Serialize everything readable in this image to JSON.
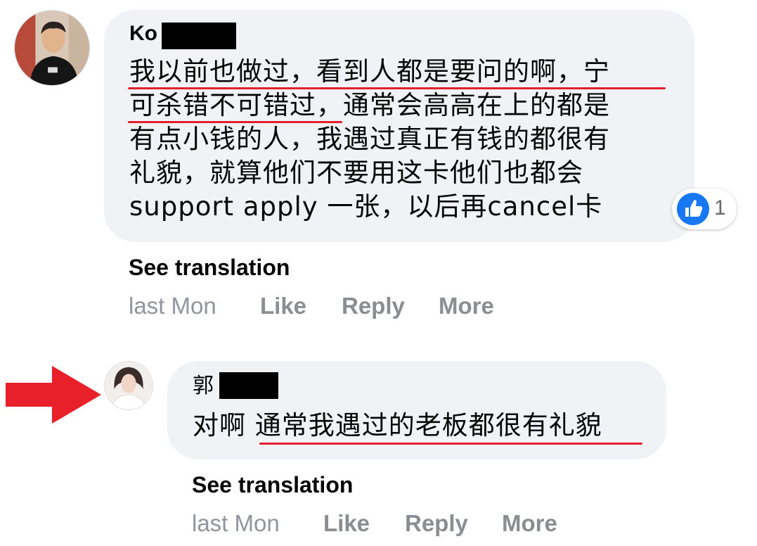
{
  "comments": [
    {
      "author_visible": "Ko",
      "lines": [
        "我以前也做过，看到人都是要问的啊，宁",
        "可杀错不可错过，通常会高高在上的都是",
        "有点小钱的人，我遇过真正有钱的都很有",
        "礼貌，就算他们不要用这卡他们也都会",
        "support apply 一张，以后再cancel卡"
      ],
      "see_translation": "See translation",
      "timestamp": "last Mon",
      "actions": {
        "like": "Like",
        "reply": "Reply",
        "more": "More"
      },
      "reaction": {
        "icon": "like-icon",
        "count": "1",
        "color": "#1877f2"
      }
    },
    {
      "author_visible": "郭",
      "lines": [
        "对啊 通常我遇过的老板都很有礼貌"
      ],
      "see_translation": "See translation",
      "timestamp": "last Mon",
      "actions": {
        "like": "Like",
        "reply": "Reply",
        "more": "More"
      }
    }
  ],
  "annotation": {
    "arrow_icon": "red-arrow-icon",
    "color": "#e8202a",
    "underline_color": "#e0202e"
  }
}
